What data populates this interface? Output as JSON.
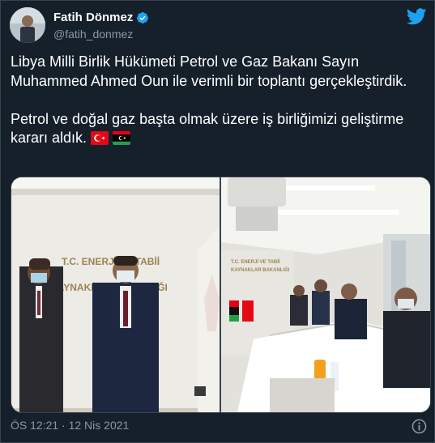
{
  "tweet": {
    "display_name": "Fatih Dönmez",
    "handle": "@fatih_donmez",
    "text_line1": "Libya Milli Birlik Hükümeti Petrol ve Gaz Bakanı Sayın Muhammed Ahmed Oun ile verimli bir toplantı gerçekleştirdik.",
    "text_line2": "Petrol ve doğal gaz başta olmak üzere iş birliğimizi geliştirme kararı aldık.",
    "timestamp": "ÖS 12:21 · 12 Nis 2021"
  },
  "photo_left": {
    "sign_line1": "T.C. ENERJİ VE TABİİ",
    "sign_line2": "KAYNAKLAR BAKANLIĞI"
  },
  "photo_right": {
    "sign_line1": "T.C. ENERJİ VE TABİİ",
    "sign_line2": "KAYNAKLAR BAKANLIĞI"
  },
  "icons": {
    "verified": "verified-badge-icon",
    "twitter": "twitter-bird-icon",
    "info": "info-icon",
    "flag_tr": "turkey-flag-icon",
    "flag_ly": "libya-flag-icon"
  },
  "colors": {
    "background": "#15202b",
    "twitter_blue": "#1da1f2",
    "secondary_text": "#8899a6",
    "border": "#38444d"
  }
}
